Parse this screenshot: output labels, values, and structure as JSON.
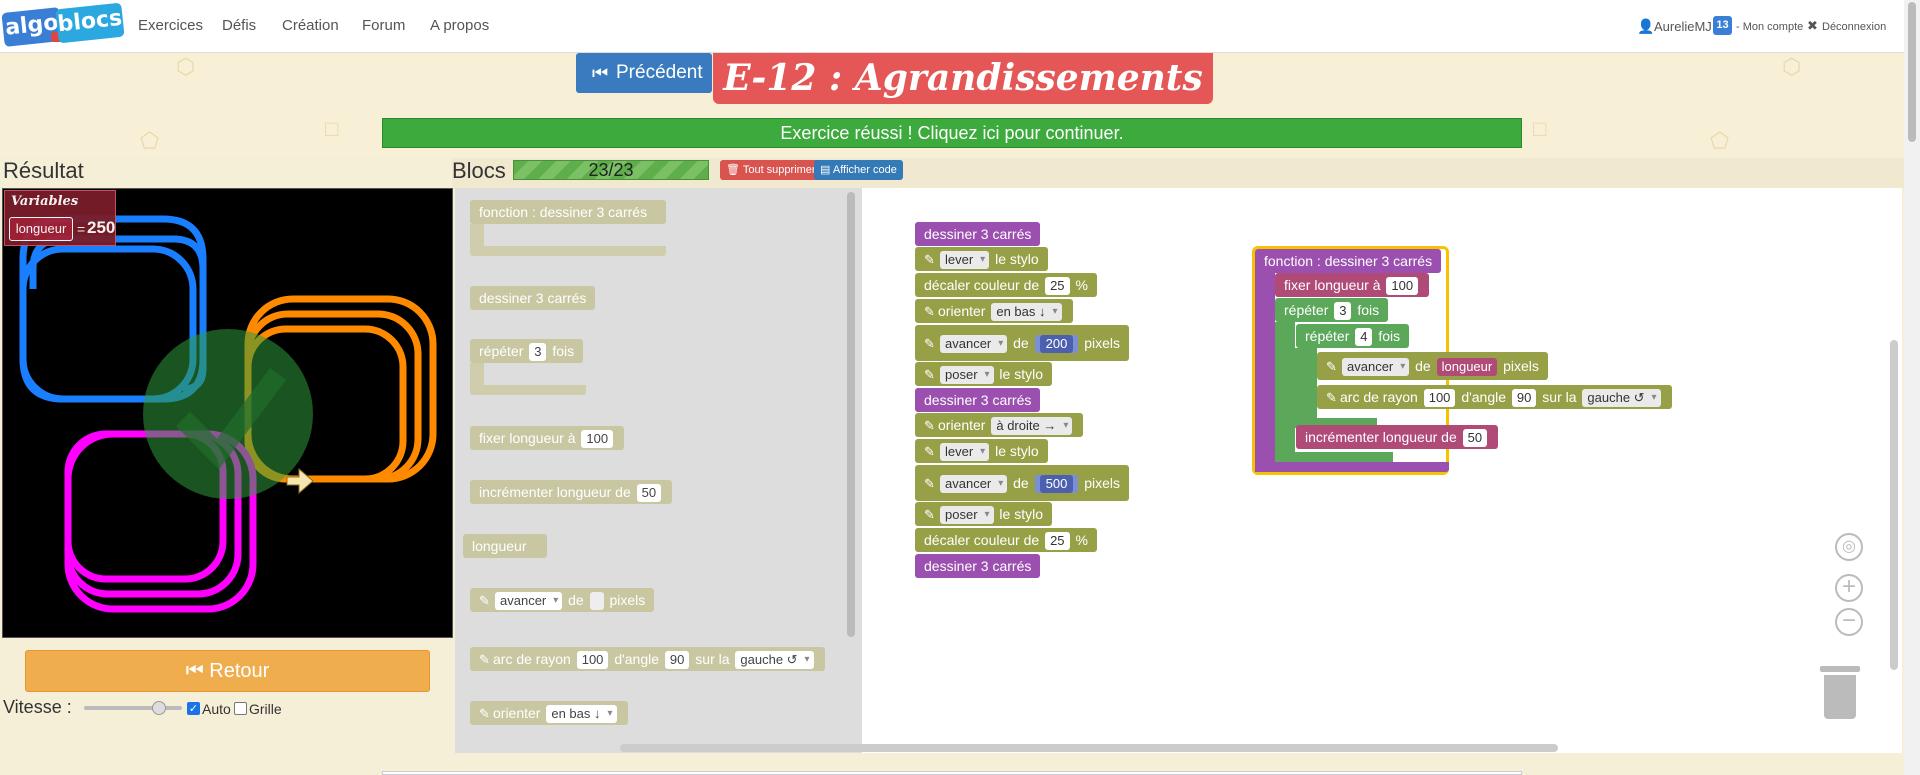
{
  "logo": {
    "word1": "algo",
    "word2": "blocs"
  },
  "nav": {
    "items": [
      "Exercices",
      "Défis",
      "Création",
      "Forum",
      "A propos"
    ],
    "user": "AurelieMJ",
    "badge": "13",
    "account": "- Mon compte",
    "logout": "Déconnexion"
  },
  "exercise": {
    "prev_label": "Précédent",
    "title": "E-12 : Agrandissements",
    "success": "Exercice réussi ! Cliquez ici pour continuer."
  },
  "result": {
    "title": "Résultat",
    "variables_heading": "Variables",
    "var_name": "longueur",
    "var_eq": "=",
    "var_value": "250",
    "retour_label": "Retour",
    "speed_label": "Vitesse :",
    "auto_label": "Auto",
    "grid_label": "Grille",
    "auto_checked": true,
    "grid_checked": false,
    "speed_level": 0.7
  },
  "blocs": {
    "title": "Blocs",
    "progress": "23/23",
    "clear_label": "Tout supprimer",
    "show_code_label": "Afficher code"
  },
  "toolbox": {
    "fn_def": "fonction : dessiner 3 carrés",
    "fn_call": "dessiner 3 carrés",
    "repeat_a": "répéter",
    "repeat_n": "3",
    "repeat_b": "fois",
    "set_len": "fixer longueur à",
    "set_len_v": "100",
    "inc_len": "incrémenter longueur de",
    "inc_len_v": "50",
    "var": "longueur",
    "fwd_opt": "avancer",
    "fwd_de": "de",
    "fwd_px": "pixels",
    "arc_a": "arc de rayon",
    "arc_r": "100",
    "arc_b": "d'angle",
    "arc_ang": "90",
    "arc_c": "sur la",
    "arc_dir": "gauche ↺",
    "orient": "orienter",
    "orient_v": "en bas ↓"
  },
  "ws": {
    "call1": "dessiner 3 carrés",
    "pen1": "lever",
    "pen_suffix": "le stylo",
    "color1_a": "décaler couleur de",
    "color1_v": "25",
    "color1_b": "%",
    "orient1": "orienter",
    "orient1_v": "en bas ↓",
    "fwd1": "avancer",
    "fwd1_de": "de",
    "fwd1_v": "200",
    "fwd1_px": "pixels",
    "pen2": "poser",
    "call2": "dessiner 3 carrés",
    "orient2_v": "à droite →",
    "pen3": "lever",
    "fwd2_v": "500",
    "pen4": "poser",
    "call3": "dessiner 3 carrés",
    "def_title": "fonction : dessiner 3 carrés",
    "def_set": "fixer longueur à",
    "def_set_v": "100",
    "def_rep": "répéter",
    "def_rep_n": "3",
    "def_rep_b": "fois",
    "def_rep2_n": "4",
    "def_fwd": "avancer",
    "def_fwd_de": "de",
    "def_fwd_var": "longueur",
    "def_fwd_px": "pixels",
    "def_arc_a": "arc de rayon",
    "def_arc_r": "100",
    "def_arc_b": "d'angle",
    "def_arc_ang": "90",
    "def_arc_c": "sur la",
    "def_arc_dir": "gauche ↺",
    "def_inc": "incrémenter longueur de",
    "def_inc_v": "50"
  },
  "colors": {
    "blue_shape": "#1a7fff",
    "orange_shape": "#ff8a00",
    "magenta_shape": "#ff00ff",
    "success": "#3daa3d",
    "title_red": "#e45756"
  }
}
